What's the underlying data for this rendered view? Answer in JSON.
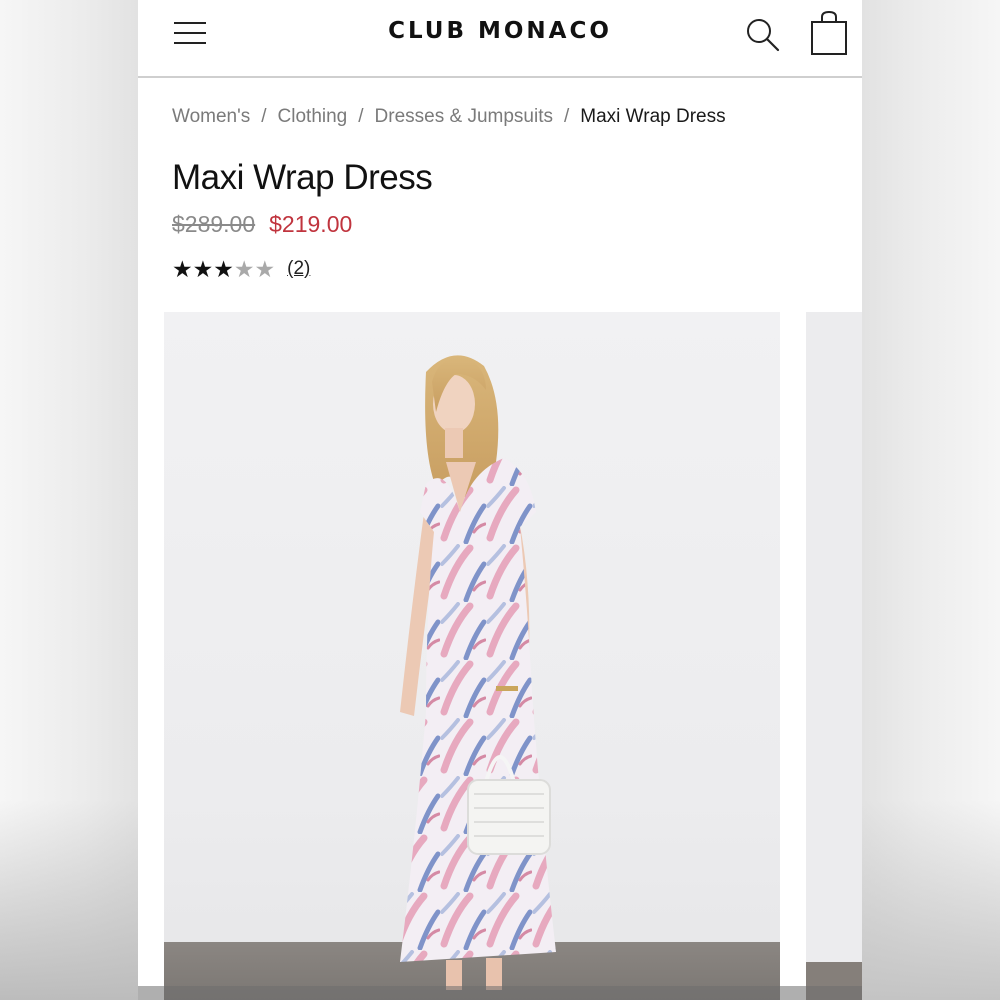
{
  "header": {
    "brand": "CLUB MONACO",
    "menu_icon": "hamburger-menu-icon",
    "search_icon": "search-icon",
    "bag_icon": "shopping-bag-icon"
  },
  "breadcrumb": {
    "items": [
      "Women's",
      "Clothing",
      "Dresses & Jumpsuits"
    ],
    "separator": "/",
    "current": "Maxi Wrap Dress"
  },
  "product": {
    "title": "Maxi Wrap Dress",
    "original_price": "$289.00",
    "sale_price": "$219.00",
    "rating": 3,
    "rating_max": 5,
    "review_count": "(2)"
  },
  "gallery": {
    "main_image_icon": "product-photo-model-in-floral-maxi-dress"
  },
  "colors": {
    "sale_price": "#c0343e",
    "original_price": "#8a8a8a",
    "star_filled": "#111111",
    "star_empty": "#a9a9a9",
    "dress_pink": "#e7a9bf",
    "dress_blue": "#7f93c9"
  }
}
